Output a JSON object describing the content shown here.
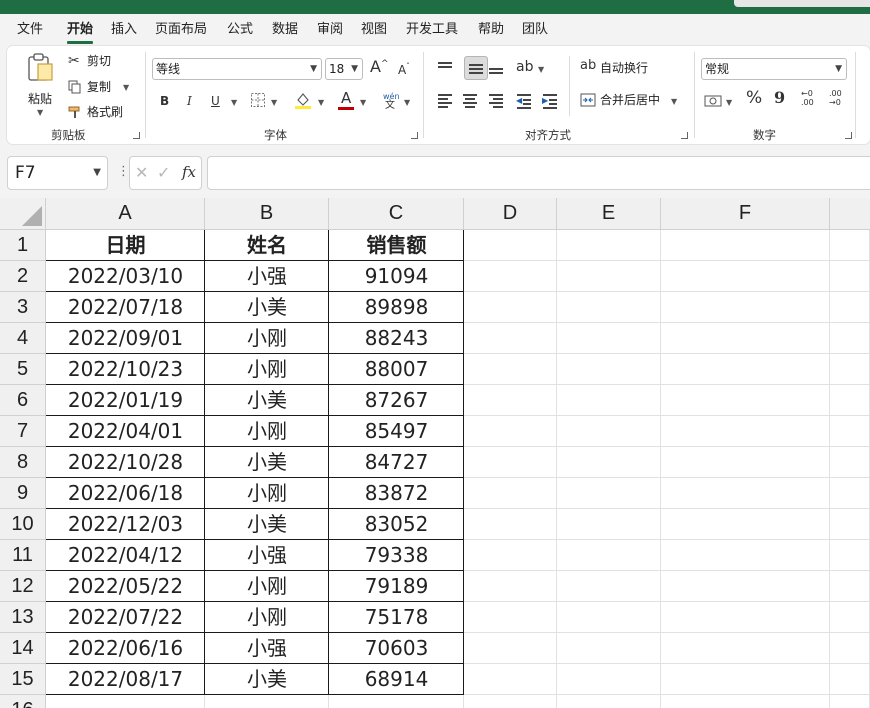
{
  "menu": {
    "items": [
      "文件",
      "开始",
      "插入",
      "页面布局",
      "公式",
      "数据",
      "审阅",
      "视图",
      "开发工具",
      "帮助",
      "团队"
    ],
    "active": "开始"
  },
  "ribbon": {
    "clipboard": {
      "paste": "粘贴",
      "cut": "剪切",
      "copy": "复制",
      "format_painter": "格式刷",
      "label": "剪贴板"
    },
    "font": {
      "name": "等线",
      "size": "18",
      "bold": "B",
      "italic": "I",
      "underline": "U",
      "grow": "A",
      "shrink": "A",
      "phonetic_top": "wén",
      "phonetic_bottom": "文",
      "label": "字体"
    },
    "alignment": {
      "wrap": "自动换行",
      "merge": "合并后居中",
      "label": "对齐方式"
    },
    "number": {
      "format": "常规",
      "percent": "%",
      "comma": "9",
      "label": "数字"
    }
  },
  "formula_bar": {
    "name_box": "F7",
    "fx": "fx",
    "value": ""
  },
  "sheet": {
    "columns": [
      "A",
      "B",
      "C",
      "D",
      "E",
      "F"
    ],
    "rows": [
      "1",
      "2",
      "3",
      "4",
      "5",
      "6",
      "7",
      "8",
      "9",
      "10",
      "11",
      "12",
      "13",
      "14",
      "15",
      "16"
    ],
    "headers": [
      "日期",
      "姓名",
      "销售额"
    ],
    "data": [
      [
        "2022/03/10",
        "小强",
        "91094"
      ],
      [
        "2022/07/18",
        "小美",
        "89898"
      ],
      [
        "2022/09/01",
        "小刚",
        "88243"
      ],
      [
        "2022/10/23",
        "小刚",
        "88007"
      ],
      [
        "2022/01/19",
        "小美",
        "87267"
      ],
      [
        "2022/04/01",
        "小刚",
        "85497"
      ],
      [
        "2022/10/28",
        "小美",
        "84727"
      ],
      [
        "2022/06/18",
        "小刚",
        "83872"
      ],
      [
        "2022/12/03",
        "小美",
        "83052"
      ],
      [
        "2022/04/12",
        "小强",
        "79338"
      ],
      [
        "2022/05/22",
        "小刚",
        "79189"
      ],
      [
        "2022/07/22",
        "小刚",
        "75178"
      ],
      [
        "2022/06/16",
        "小强",
        "70603"
      ],
      [
        "2022/08/17",
        "小美",
        "68914"
      ]
    ]
  },
  "colors": {
    "accent": "#1f6e43",
    "font_color": "#c00000",
    "fill_color": "#ffeb3b"
  }
}
